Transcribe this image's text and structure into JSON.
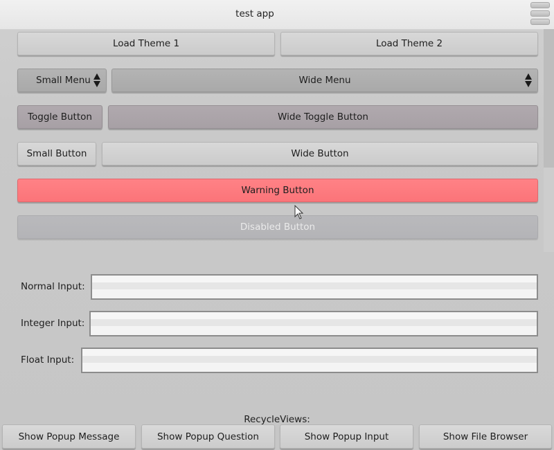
{
  "window": {
    "title": "test app"
  },
  "buttons": {
    "load_theme_1": "Load Theme 1",
    "load_theme_2": "Load Theme 2",
    "small_menu": "Small Menu",
    "wide_menu": "Wide Menu",
    "toggle_button": "Toggle Button",
    "wide_toggle_button": "Wide Toggle Button",
    "small_button": "Small Button",
    "wide_button": "Wide Button",
    "warning_button": "Warning Button",
    "disabled_button": "Disabled Button"
  },
  "inputs": {
    "normal_label": "Normal Input:",
    "normal_value": "",
    "integer_label": "Integer Input:",
    "integer_value": "",
    "float_label": "Float Input:",
    "float_value": ""
  },
  "recycle_views_label": "RecycleViews:",
  "bottom_bar": {
    "show_popup_message": "Show Popup Message",
    "show_popup_question": "Show Popup Question",
    "show_popup_input": "Show Popup Input",
    "show_file_browser": "Show File Browser"
  },
  "colors": {
    "warning": "#ff7e82",
    "toggle": "#aca5aa",
    "menu": "#afafaf"
  },
  "icons": {
    "menu": "hamburger-menu-icon",
    "dropdown": "up-down-arrows-icon",
    "cursor": "mouse-pointer-icon"
  }
}
